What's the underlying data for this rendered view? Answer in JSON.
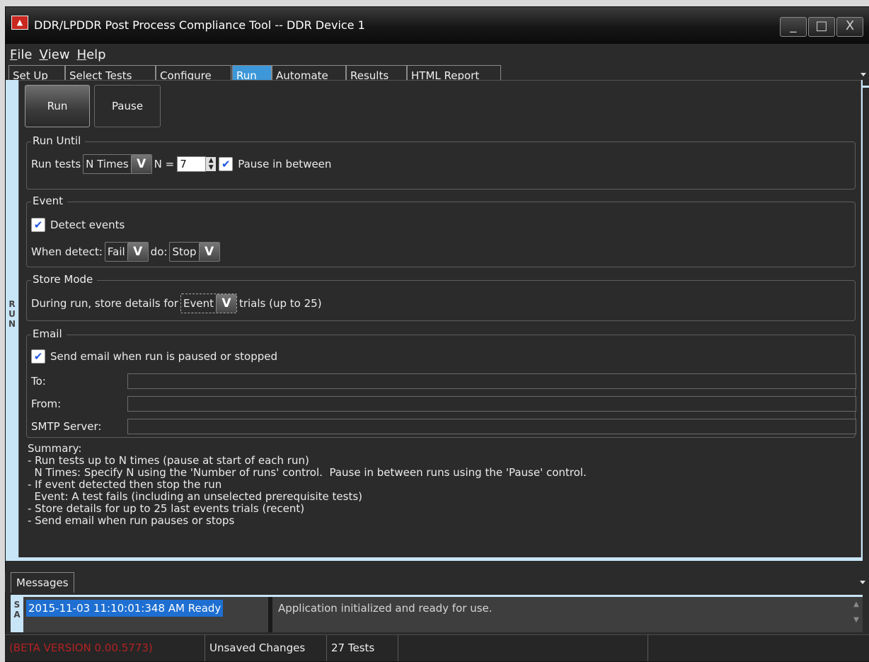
{
  "window": {
    "title": "DDR/LPDDR Post Process Compliance Tool -- DDR Device 1",
    "app_icon": "compliance-app-icon",
    "buttons": {
      "minimize": "_",
      "maximize": "□",
      "close": "X"
    }
  },
  "menu": {
    "file": "File",
    "view": "View",
    "help": "Help"
  },
  "tabs": [
    "Set Up",
    "Select Tests",
    "Configure",
    "Run",
    "Automate",
    "Results",
    "HTML Report"
  ],
  "active_tab": "Run",
  "side_label": "RUN",
  "run_panel": {
    "run_button": "Run",
    "pause_button": "Pause",
    "run_until": {
      "legend": "Run Until",
      "run_tests_label": "Run tests",
      "mode_value": "N Times",
      "n_label": "N =",
      "n_value": "7",
      "pause_between_label": "Pause in between",
      "pause_between_checked": true
    },
    "event": {
      "legend": "Event",
      "detect_label": "Detect events",
      "detect_checked": true,
      "when_detect_label": "When detect:",
      "when_value": "Fail",
      "do_label": "do:",
      "do_value": "Stop"
    },
    "store_mode": {
      "legend": "Store Mode",
      "prefix": "During run, store details for",
      "value": "Event",
      "suffix": "trials (up to 25)"
    },
    "email": {
      "legend": "Email",
      "send_label": "Send email when run is paused or stopped",
      "send_checked": true,
      "to_label": "To:",
      "to_value": "",
      "from_label": "From:",
      "from_value": "",
      "smtp_label": "SMTP Server:",
      "smtp_value": ""
    },
    "summary": [
      "Summary:",
      "- Run tests up to N times (pause at start of each run)",
      "  N Times: Specify N using the 'Number of runs' control.  Pause in between runs using the 'Pause' control.",
      "- If event detected then stop the run",
      "  Event: A test fails (including an unselected prerequisite tests)",
      "- Store details for up to 25 last events trials (recent)",
      "- Send email when run pauses or stops"
    ]
  },
  "messages": {
    "tab_label": "Messages",
    "side_label": "SA",
    "stamp": "2015-11-03 11:10:01:348 AM Ready",
    "text": "Application initialized and ready for use."
  },
  "status": {
    "version": "(BETA VERSION 0.00.5773)",
    "unsaved": "Unsaved Changes",
    "tests": "27 Tests"
  },
  "colors": {
    "accent": "#3d97d9",
    "panel_strip": "#c8e5f8",
    "version_text": "#b22222",
    "checkmark": "#2356e0",
    "selected_message": "#1e6fd1"
  }
}
